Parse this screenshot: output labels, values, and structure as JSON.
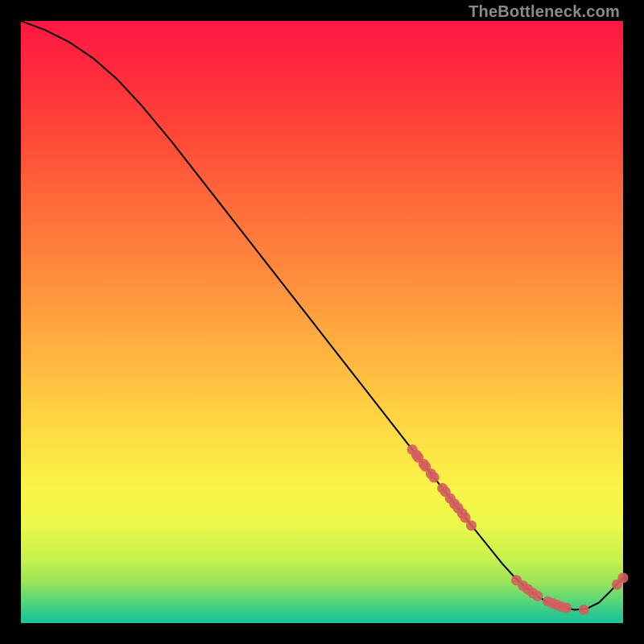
{
  "watermark": "TheBottleneck.com",
  "chart_data": {
    "type": "line",
    "title": "",
    "xlabel": "",
    "ylabel": "",
    "xlim": [
      0,
      100
    ],
    "ylim": [
      0,
      100
    ],
    "grid": false,
    "legend": false,
    "annotations": [],
    "curve": {
      "name": "bottleneck-curve",
      "x": [
        0,
        4,
        8,
        12,
        16,
        20,
        25,
        30,
        35,
        40,
        45,
        50,
        55,
        60,
        65,
        70,
        75,
        80,
        82,
        84,
        86,
        88,
        90,
        92,
        94,
        96,
        98,
        100
      ],
      "y": [
        100,
        98.5,
        96.5,
        93.8,
        90.3,
        86,
        80,
        73.6,
        67.2,
        60.8,
        54.4,
        48,
        41.6,
        35.2,
        28.8,
        22.4,
        16,
        9.8,
        7.6,
        5.8,
        4.3,
        3.2,
        2.5,
        2.2,
        2.4,
        3.4,
        5.4,
        7.5
      ]
    },
    "marker_clusters": [
      {
        "name": "upper-cluster",
        "color": "#d35e5e",
        "points": [
          {
            "x": 65.0,
            "y": 28.8
          },
          {
            "x": 65.7,
            "y": 27.9
          },
          {
            "x": 66.0,
            "y": 27.5
          },
          {
            "x": 66.9,
            "y": 26.4
          },
          {
            "x": 67.2,
            "y": 26.0
          },
          {
            "x": 68.1,
            "y": 24.8
          },
          {
            "x": 68.6,
            "y": 24.2
          },
          {
            "x": 70.0,
            "y": 22.4
          },
          {
            "x": 70.5,
            "y": 21.8
          },
          {
            "x": 71.3,
            "y": 20.7
          },
          {
            "x": 72.0,
            "y": 19.8
          },
          {
            "x": 72.6,
            "y": 19.1
          },
          {
            "x": 73.3,
            "y": 18.2
          },
          {
            "x": 73.8,
            "y": 17.5
          },
          {
            "x": 74.8,
            "y": 16.2
          }
        ]
      },
      {
        "name": "bottom-cluster",
        "color": "#d35e5e",
        "points": [
          {
            "x": 82.3,
            "y": 7.1
          },
          {
            "x": 83.4,
            "y": 6.2
          },
          {
            "x": 84.2,
            "y": 5.6
          },
          {
            "x": 85.0,
            "y": 5.0
          },
          {
            "x": 85.8,
            "y": 4.5
          },
          {
            "x": 87.5,
            "y": 3.6
          },
          {
            "x": 88.3,
            "y": 3.3
          },
          {
            "x": 89.0,
            "y": 3.0
          },
          {
            "x": 89.8,
            "y": 2.7
          },
          {
            "x": 90.6,
            "y": 2.5
          },
          {
            "x": 93.5,
            "y": 2.2
          }
        ]
      },
      {
        "name": "right-pair",
        "color": "#d35e5e",
        "points": [
          {
            "x": 99.0,
            "y": 6.4
          },
          {
            "x": 100.0,
            "y": 7.5
          }
        ]
      }
    ]
  }
}
